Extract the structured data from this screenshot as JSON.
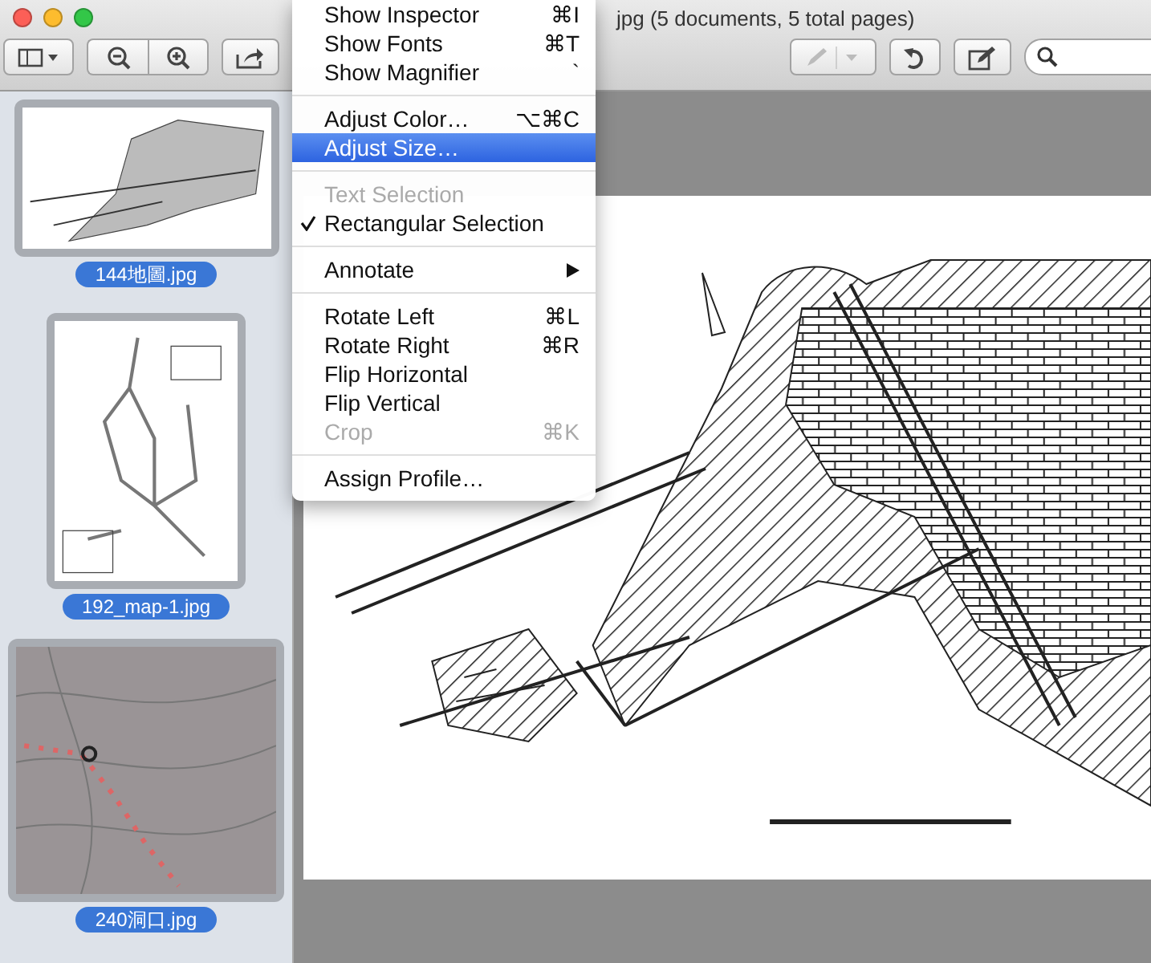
{
  "window": {
    "title": "jpg (5 documents, 5 total pages)"
  },
  "toolbar": {
    "annotate": {
      "disabled": true
    }
  },
  "sidebar": {
    "items": [
      {
        "label": "144地圖.jpg",
        "selected": true,
        "kind": "landscape"
      },
      {
        "label": "192_map-1.jpg",
        "selected": true,
        "kind": "portrait"
      },
      {
        "label": "240洞口.jpg",
        "selected": true,
        "kind": "square"
      }
    ]
  },
  "menu": {
    "items": [
      {
        "kind": "item",
        "label": "Show Inspector",
        "shortcut": "⌘I",
        "selected": false,
        "disabled": false,
        "checked": false
      },
      {
        "kind": "item",
        "label": "Show Fonts",
        "shortcut": "⌘T",
        "selected": false,
        "disabled": false,
        "checked": false
      },
      {
        "kind": "item",
        "label": "Show Magnifier",
        "shortcut": "`",
        "selected": false,
        "disabled": false,
        "checked": false
      },
      {
        "kind": "separator"
      },
      {
        "kind": "item",
        "label": "Adjust Color…",
        "shortcut": "⌥⌘C",
        "selected": false,
        "disabled": false,
        "checked": false
      },
      {
        "kind": "item",
        "label": "Adjust Size…",
        "selected": true,
        "disabled": false,
        "checked": false
      },
      {
        "kind": "separator"
      },
      {
        "kind": "item",
        "label": "Text Selection",
        "selected": false,
        "disabled": true,
        "checked": false
      },
      {
        "kind": "item",
        "label": "Rectangular Selection",
        "selected": false,
        "disabled": false,
        "checked": true
      },
      {
        "kind": "separator"
      },
      {
        "kind": "submenu",
        "label": "Annotate",
        "selected": false,
        "disabled": false,
        "checked": false
      },
      {
        "kind": "separator"
      },
      {
        "kind": "item",
        "label": "Rotate Left",
        "shortcut": "⌘L",
        "selected": false,
        "disabled": false,
        "checked": false
      },
      {
        "kind": "item",
        "label": "Rotate Right",
        "shortcut": "⌘R",
        "selected": false,
        "disabled": false,
        "checked": false
      },
      {
        "kind": "item",
        "label": "Flip Horizontal",
        "selected": false,
        "disabled": false,
        "checked": false
      },
      {
        "kind": "item",
        "label": "Flip Vertical",
        "selected": false,
        "disabled": false,
        "checked": false
      },
      {
        "kind": "item",
        "label": "Crop",
        "shortcut": "⌘K",
        "selected": false,
        "disabled": true,
        "checked": false
      },
      {
        "kind": "separator"
      },
      {
        "kind": "item",
        "label": "Assign Profile…",
        "selected": false,
        "disabled": false,
        "checked": false
      }
    ]
  }
}
